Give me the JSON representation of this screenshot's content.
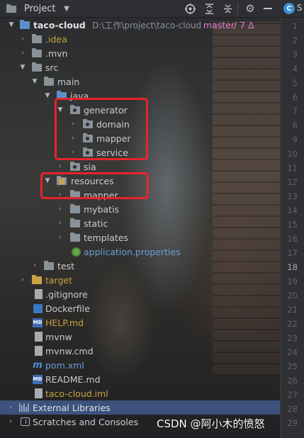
{
  "toolbar": {
    "title": "Project",
    "icons": [
      "project-view-icon",
      "target-icon",
      "expand-all-icon",
      "collapse-all-icon",
      "settings-icon",
      "hide-icon"
    ],
    "tab_partial": "S"
  },
  "tree": {
    "project_name": "taco-cloud",
    "project_path": "D:\\工作\\project\\taco-cloud",
    "branch": "master",
    "changes": "/ 7 Δ",
    "rows": [
      {
        "label": "generator"
      },
      {
        "label": "domain"
      },
      {
        "label": "mapper"
      },
      {
        "label": "service"
      },
      {
        "label": "sia"
      },
      {
        "label": "resources"
      },
      {
        "label": "mapper"
      },
      {
        "label": "mybatis"
      },
      {
        "label": "static"
      },
      {
        "label": "templates"
      }
    ],
    "idea": ".idea",
    "mvn": ".mvn",
    "src": "src",
    "main": "main",
    "java": "java",
    "app_props": "application.properties",
    "test": "test",
    "target": "target",
    "gitignore": ".gitignore",
    "dockerfile": "Dockerfile",
    "help": "HELP.md",
    "mvnw": "mvnw",
    "mvnw_cmd": "mvnw.cmd",
    "pom": "pom.xml",
    "readme": "README.md",
    "iml": "taco-cloud.iml",
    "ext_libs": "External Libraries",
    "scratches": "Scratches and Consoles"
  },
  "colors": {
    "accent_red": "#e6252a",
    "branch_pink": "#e37bd0",
    "git_new": "#6a9fd8",
    "git_ignored": "#c8a23c",
    "selected_row": "#415a8c"
  },
  "gutter": {
    "lines": [
      "1",
      "2",
      "3",
      "4",
      "5",
      "6",
      "7",
      "8",
      "9",
      "10",
      "11",
      "12",
      "13",
      "14",
      "15",
      "16",
      "17",
      "18",
      "19",
      "20",
      "21",
      "22",
      "23",
      "24",
      "25",
      "26",
      "27",
      "28",
      "29"
    ],
    "current": "18"
  },
  "watermark": "CSDN @阿小木的愤怒"
}
